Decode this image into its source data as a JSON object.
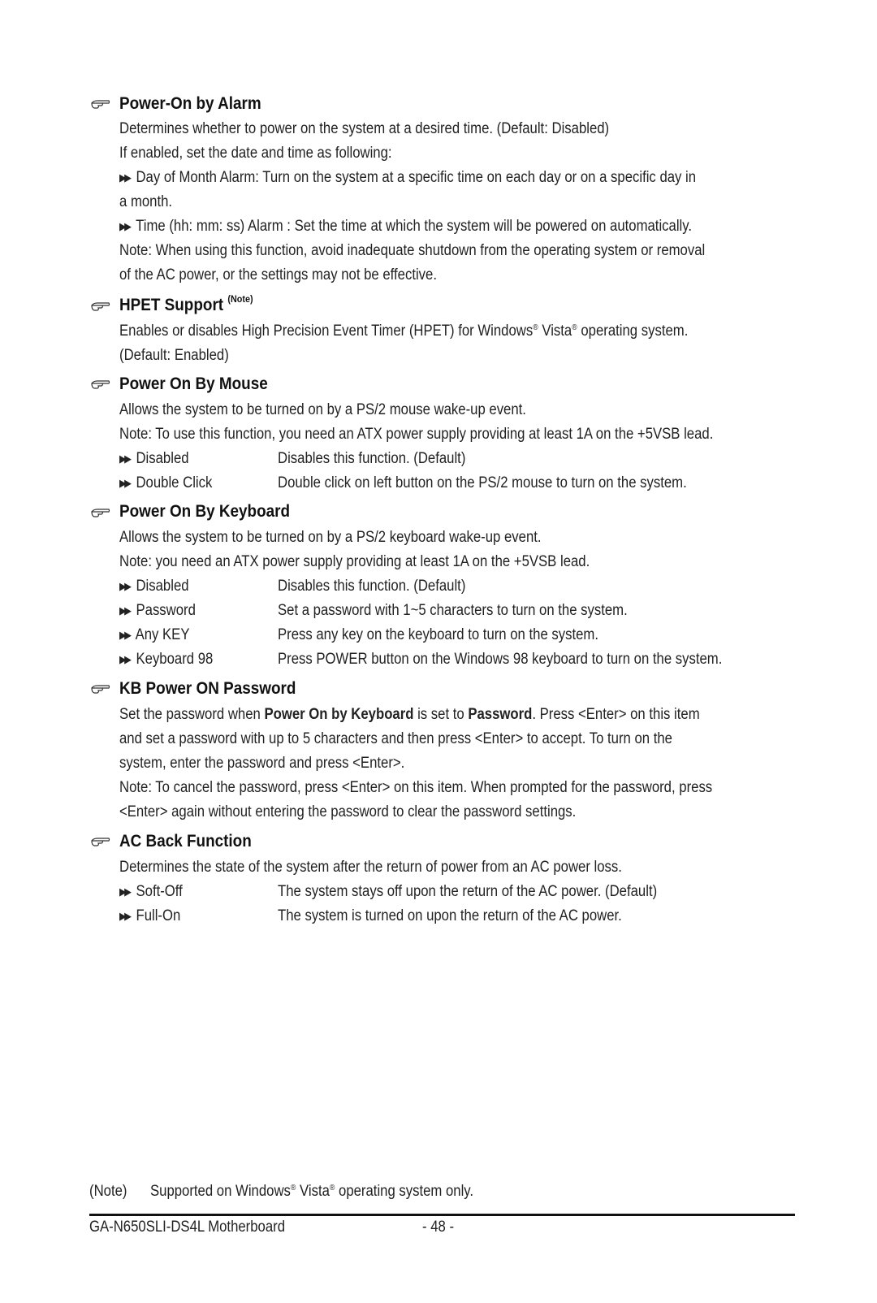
{
  "sections": [
    {
      "title": "Power-On by Alarm",
      "lines": [
        "Determines whether to power on the system at a desired time. (Default: Disabled)",
        "If enabled, set the date and time as following:",
        "Day of Month Alarm: Turn on the system at a specific time on each day or on a specific day in",
        "a month.",
        "Time (hh: mm: ss) Alarm : Set the time at which the system will be powered on automatically.",
        "Note: When using this function, avoid inadequate shutdown from the operating system or removal",
        "of the AC power, or the settings may not be effective."
      ]
    },
    {
      "title": "HPET Support",
      "title_note": "(Note)",
      "lines": [
        "Enables or disables High Precision Event Timer (HPET) for Windows",
        "Vista",
        "operating system.",
        "(Default: Enabled)"
      ]
    },
    {
      "title": "Power On By Mouse",
      "lines": [
        "Allows the system to be turned on by a PS/2 mouse wake-up event.",
        "Note: To use this function, you need an ATX power supply providing at least 1A on the +5VSB lead."
      ],
      "options": [
        {
          "name": "Disabled",
          "desc": "Disables this function. (Default)"
        },
        {
          "name": "Double Click",
          "desc": "Double click on left button on the PS/2 mouse to turn on the system."
        }
      ]
    },
    {
      "title": "Power On By Keyboard",
      "lines": [
        "Allows the system to be turned on by a PS/2 keyboard wake-up event.",
        "Note: you need an ATX power supply providing at least 1A on the +5VSB lead."
      ],
      "options": [
        {
          "name": "Disabled",
          "desc": "Disables this function. (Default)"
        },
        {
          "name": "Password",
          "desc": "Set a password with 1~5 characters to turn on the system."
        },
        {
          "name": "Any KEY",
          "desc": "Press any key on the keyboard to turn on the system."
        },
        {
          "name": "Keyboard 98",
          "desc": "Press POWER button on the Windows 98 keyboard to turn on the system."
        }
      ]
    },
    {
      "title": "KB Power ON Password",
      "line1_a": "Set the password when ",
      "line1_b": "Power On by Keyboard",
      "line1_c": " is set to ",
      "line1_d": "Password",
      "line1_e": ". Press <Enter> on this item",
      "lines": [
        "and set a password with up to 5 characters and then press <Enter> to accept. To turn on the",
        "system, enter the password and press <Enter>.",
        "Note: To cancel the password, press <Enter> on this item. When prompted for the password, press",
        "<Enter> again without entering the password to clear the password settings."
      ]
    },
    {
      "title": "AC Back Function",
      "lines": [
        "Determines the state of the system after the return of power from an AC power loss."
      ],
      "options": [
        {
          "name": "Soft-Off",
          "desc": "The system stays off upon the return of the AC power. (Default)"
        },
        {
          "name": "Full-On",
          "desc": "The system is turned on upon the return of the AC power."
        }
      ]
    }
  ],
  "footnote": {
    "label": "(Note)",
    "text_a": "Supported on Windows",
    "text_b": " Vista",
    "text_c": " operating system only."
  },
  "reg_mark": "®",
  "bullet_glyph": "▶▶",
  "footer": {
    "product": "GA-N650SLI-DS4L Motherboard",
    "page": "- 48 -"
  }
}
